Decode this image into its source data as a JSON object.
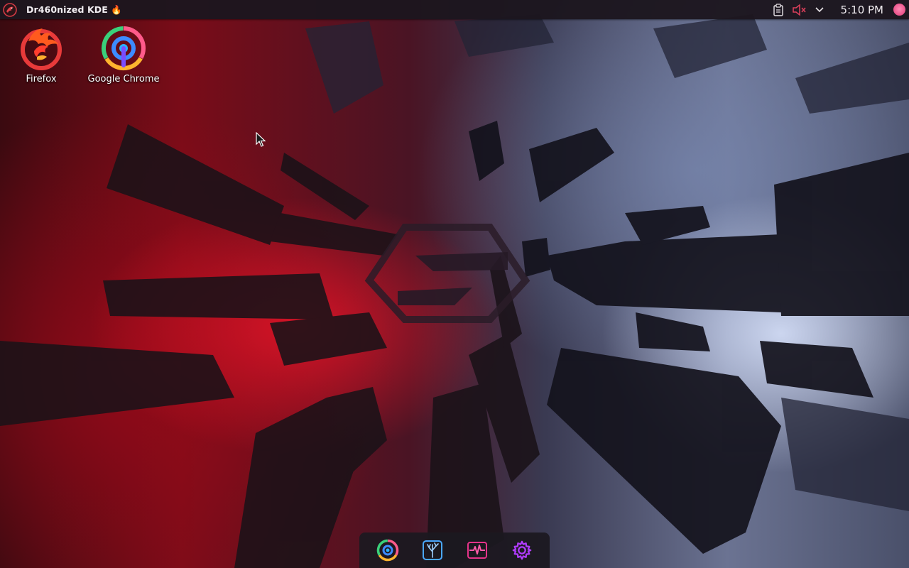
{
  "panel": {
    "launcher_icon": "dragon-logo-icon",
    "window_title": "Dr460nized KDE 🔥",
    "tray": {
      "clipboard_icon": "clipboard-icon",
      "volume_icon": "volume-muted-icon",
      "expand_icon": "chevron-down-icon",
      "clock": "5:10 PM",
      "avatar_icon": "user-avatar"
    }
  },
  "desktop": {
    "icons": [
      {
        "label": "Firefox",
        "icon": "firefox-icon"
      },
      {
        "label": "Google Chrome",
        "icon": "chrome-icon"
      }
    ]
  },
  "dock": {
    "items": [
      {
        "name": "chrome",
        "icon": "chrome-icon"
      },
      {
        "name": "file-manager",
        "icon": "tree-folder-icon"
      },
      {
        "name": "system-monitor",
        "icon": "activity-icon"
      },
      {
        "name": "settings",
        "icon": "gear-icon"
      }
    ]
  },
  "colors": {
    "accent_pink": "#e6338a",
    "accent_blue": "#4aa8ff",
    "accent_purple": "#9b3cff",
    "panel_bg": "#1c161e"
  }
}
